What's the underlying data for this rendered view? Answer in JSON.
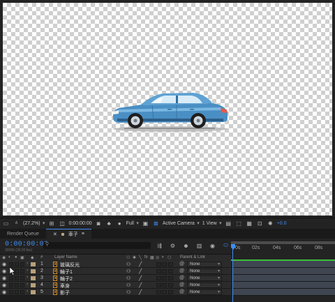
{
  "viewer": {
    "zoom": "(27.2%)",
    "timecode": "0:00:00:00",
    "resolution": "Full",
    "camera": "Active Camera",
    "views": "1 View",
    "exposure": "+0.0"
  },
  "tabs": {
    "render_queue": "Render Queue",
    "composition": "車子"
  },
  "timeline": {
    "current_time": "0:00:00:00",
    "fps_info": "00000 (30.00 fps)",
    "ruler_labels": [
      "0s",
      "02s",
      "04s",
      "06s",
      "08s"
    ],
    "columns": {
      "label": "#",
      "layer_name": "Layer Name",
      "parent": "Parent & Link"
    }
  },
  "layers": [
    {
      "num": "1",
      "name": "玻璃反光",
      "parent": "None"
    },
    {
      "num": "2",
      "name": "輪子1",
      "parent": "None"
    },
    {
      "num": "3",
      "name": "輪子2",
      "parent": "None"
    },
    {
      "num": "4",
      "name": "車身",
      "parent": "None"
    },
    {
      "num": "5",
      "name": "影子",
      "parent": "None"
    }
  ],
  "colors": {
    "accent": "#3d8df5",
    "label_sandstone": "#b7a27a",
    "track_bar": "#3f4652",
    "work_area_green": "#3bbf3b",
    "car_body": "#4a8fc4"
  }
}
